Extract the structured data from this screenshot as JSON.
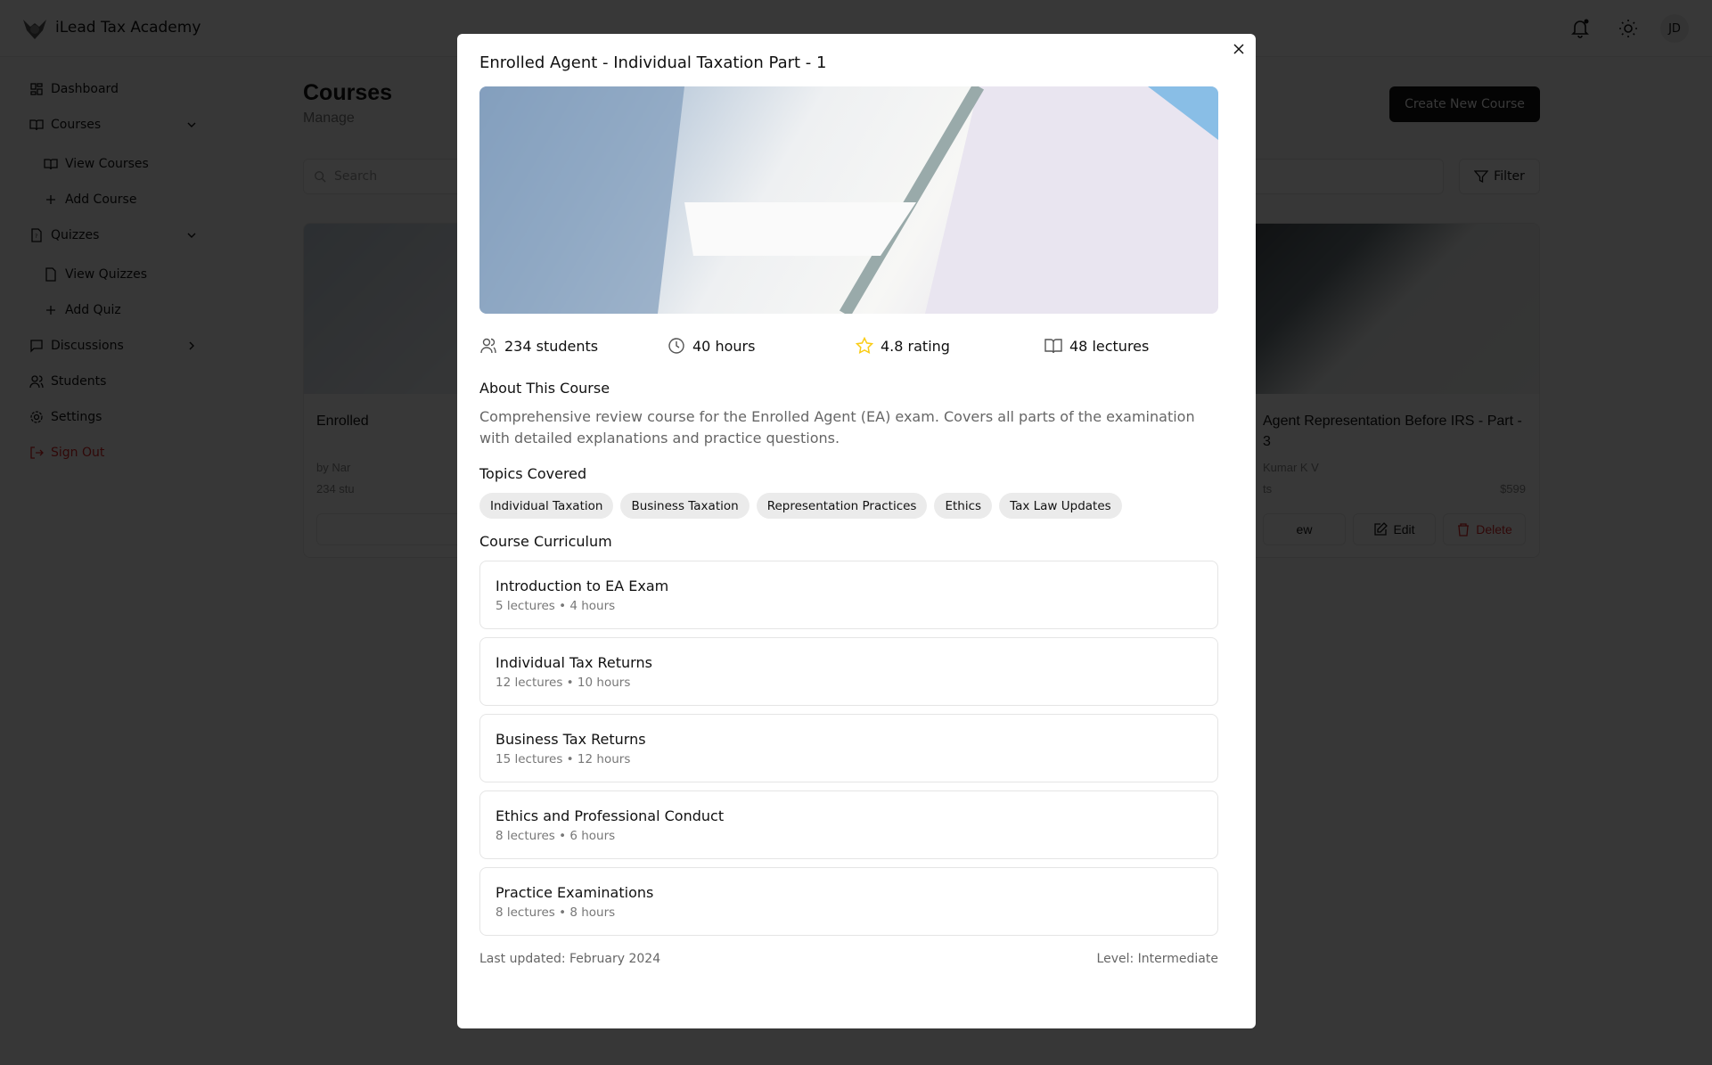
{
  "app": {
    "brand": "iLead Tax Academy",
    "avatar": "JD"
  },
  "sidebar": {
    "items": [
      {
        "label": "Dashboard",
        "icon": "dashboard-icon"
      },
      {
        "label": "Courses",
        "icon": "book-icon"
      },
      {
        "label": "View Courses",
        "icon": "book-icon"
      },
      {
        "label": "Add Course",
        "icon": "plus-icon"
      },
      {
        "label": "Quizzes",
        "icon": "quiz-icon"
      },
      {
        "label": "View Quizzes",
        "icon": "quiz-icon"
      },
      {
        "label": "Add Quiz",
        "icon": "plus-icon"
      },
      {
        "label": "Discussions",
        "icon": "chat-icon"
      },
      {
        "label": "Students",
        "icon": "users-icon"
      },
      {
        "label": "Settings",
        "icon": "gear-icon"
      },
      {
        "label": "Sign Out",
        "icon": "sign-out-icon"
      }
    ]
  },
  "main": {
    "title": "Courses",
    "subtitle": "Manage",
    "create_label": "Create New Course",
    "search_placeholder": "Search",
    "filter_label": "Filter",
    "cards": [
      {
        "title": "Enrolled",
        "by": "by Nar",
        "meta": "234 stu",
        "price": "",
        "btns": [
          "",
          "",
          ""
        ]
      },
      {
        "title": "Agent Representation Before IRS - Part - 3",
        "by": "Kumar K V",
        "meta": "ts",
        "price": "$599",
        "btns": [
          "ew",
          "Edit",
          "Delete"
        ]
      }
    ]
  },
  "modal": {
    "title": "Enrolled Agent - Individual Taxation Part - 1",
    "stats": {
      "students": "234 students",
      "hours": "40 hours",
      "rating": "4.8 rating",
      "lectures": "48 lectures"
    },
    "about_title": "About This Course",
    "description": "Comprehensive review course for the Enrolled Agent (EA) exam. Covers all parts of the examination with detailed explanations and practice questions.",
    "topics_title": "Topics Covered",
    "topics": [
      "Individual Taxation",
      "Business Taxation",
      "Representation Practices",
      "Ethics",
      "Tax Law Updates"
    ],
    "curriculum_title": "Course Curriculum",
    "curriculum": [
      {
        "title": "Introduction to EA Exam",
        "sub": "5 lectures • 4 hours"
      },
      {
        "title": "Individual Tax Returns",
        "sub": "12 lectures • 10 hours"
      },
      {
        "title": "Business Tax Returns",
        "sub": "15 lectures • 12 hours"
      },
      {
        "title": "Ethics and Professional Conduct",
        "sub": "8 lectures • 6 hours"
      },
      {
        "title": "Practice Examinations",
        "sub": "8 lectures • 8 hours"
      }
    ],
    "last_updated": "Last updated: February 2024",
    "level": "Level: Intermediate"
  },
  "colors": {
    "star": "#facc15",
    "danger": "#dc2626",
    "overlay": "rgba(0,0,0,0.8)"
  }
}
